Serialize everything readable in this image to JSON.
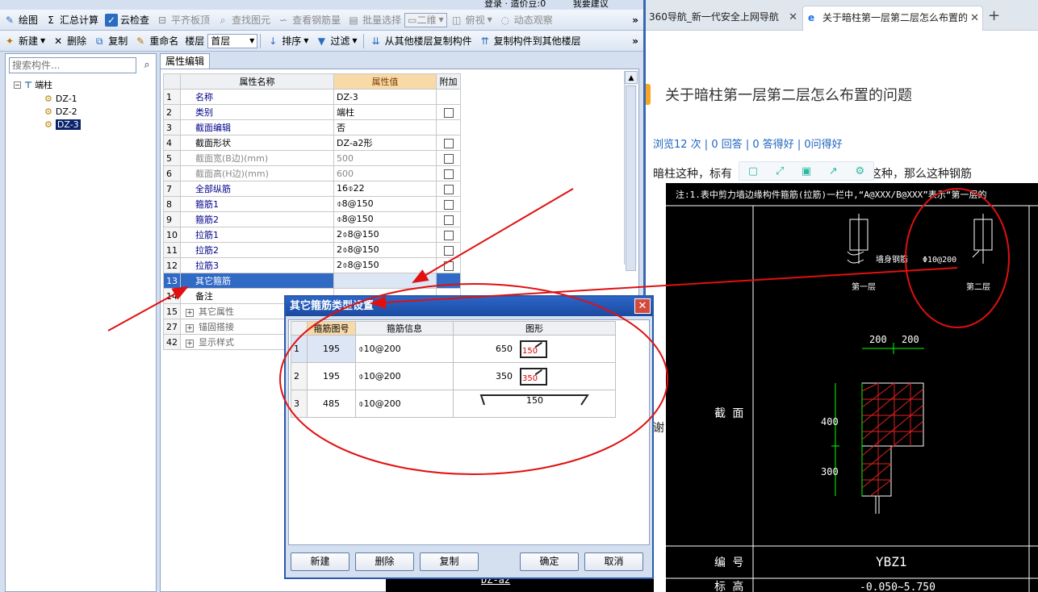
{
  "app": {
    "title_fragment": "登录 · 造价豆:0",
    "title_fragment2": "我要建议",
    "toolbar1": [
      {
        "label": "绘图",
        "icon": "pencil-icon",
        "disabled": false
      },
      {
        "label": "汇总计算",
        "icon": "sigma-icon",
        "disabled": false
      },
      {
        "label": "云检查",
        "icon": "cloud-check-icon",
        "disabled": false
      },
      {
        "label": "平齐板顶",
        "icon": "align-icon",
        "disabled": true
      },
      {
        "label": "查找图元",
        "icon": "find-icon",
        "disabled": true
      },
      {
        "label": "查看钢筋量",
        "icon": "rebar-icon",
        "disabled": true
      },
      {
        "label": "批量选择",
        "icon": "batch-icon",
        "disabled": true
      },
      {
        "label": "二维",
        "icon": "view2d-icon",
        "disabled": true
      },
      {
        "label": "俯视",
        "icon": "topview-icon",
        "disabled": true
      },
      {
        "label": "动态观察",
        "icon": "orbit-icon",
        "disabled": true
      }
    ],
    "toolbar2": {
      "new_label": "新建",
      "delete_label": "删除",
      "copy_label": "复制",
      "rename_label": "重命名",
      "floor_label": "楼层",
      "floor_value": "首层",
      "sort_label": "排序",
      "filter_label": "过滤",
      "copy_from_label": "从其他楼层复制构件",
      "copy_to_label": "复制构件到其他楼层"
    },
    "tree": {
      "search_placeholder": "搜索构件...",
      "root_label": "端柱",
      "items": [
        "DZ-1",
        "DZ-2",
        "DZ-3"
      ],
      "selected": "DZ-3"
    },
    "property_tab": "属性编辑",
    "property_table": {
      "headers": [
        "属性名称",
        "属性值",
        "附加"
      ],
      "rows": [
        {
          "num": "1",
          "name": "名称",
          "value": "DZ-3",
          "check": false,
          "style": "link"
        },
        {
          "num": "2",
          "name": "类别",
          "value": "端柱",
          "check": true,
          "style": "link"
        },
        {
          "num": "3",
          "name": "截面编辑",
          "value": "否",
          "check": false,
          "style": "link"
        },
        {
          "num": "4",
          "name": "截面形状",
          "value": "DZ-a2形",
          "check": true,
          "style": "plain"
        },
        {
          "num": "5",
          "name": "截面宽(B边)(mm)",
          "value": "500",
          "check": true,
          "style": "grey"
        },
        {
          "num": "6",
          "name": "截面高(H边)(mm)",
          "value": "600",
          "check": true,
          "style": "grey"
        },
        {
          "num": "7",
          "name": "全部纵筋",
          "value": "16⌽22",
          "check": true,
          "style": "link"
        },
        {
          "num": "8",
          "name": "箍筋1",
          "value": "⌽8@150",
          "check": true,
          "style": "link"
        },
        {
          "num": "9",
          "name": "箍筋2",
          "value": "⌽8@150",
          "check": true,
          "style": "link"
        },
        {
          "num": "10",
          "name": "拉筋1",
          "value": "2⌽8@150",
          "check": true,
          "style": "link"
        },
        {
          "num": "11",
          "name": "拉筋2",
          "value": "2⌽8@150",
          "check": true,
          "style": "link"
        },
        {
          "num": "12",
          "name": "拉筋3",
          "value": "2⌽8@150",
          "check": true,
          "style": "link"
        },
        {
          "num": "13",
          "name": "其它箍筋",
          "value": "",
          "check": false,
          "style": "selected"
        },
        {
          "num": "14",
          "name": "备注",
          "value": "",
          "check": false,
          "style": "plain"
        },
        {
          "num": "15",
          "name": "其它属性",
          "value": "",
          "check": false,
          "style": "group"
        },
        {
          "num": "27",
          "name": "锚固搭接",
          "value": "",
          "check": false,
          "style": "group"
        },
        {
          "num": "42",
          "name": "显示样式",
          "value": "",
          "check": false,
          "style": "group"
        }
      ]
    }
  },
  "dialog": {
    "title": "其它箍筋类型设置",
    "headers": [
      "箍筋图号",
      "箍筋信息",
      "图形"
    ],
    "rows": [
      {
        "num": "1",
        "code": "195",
        "info": "⌽10@200",
        "len": "650",
        "inner": "150"
      },
      {
        "num": "2",
        "code": "195",
        "info": "⌽10@200",
        "len": "350",
        "inner": "350"
      },
      {
        "num": "3",
        "code": "485",
        "info": "⌽10@200",
        "len": "",
        "inner": "150"
      }
    ],
    "buttons": {
      "new": "新建",
      "delete": "删除",
      "copy": "复制",
      "ok": "确定",
      "cancel": "取消"
    },
    "bottom_label": "DZ-a2"
  },
  "browser": {
    "tab1": "360导航_新一代安全上网导航",
    "tab2": "关于暗柱第一层第二层怎么布置的",
    "question_title": "关于暗柱第一层第二层怎么布置的问题",
    "stats": "浏览12 次 | 0 回答 | 0 答得好 | 0问得好",
    "body_start": "暗柱这种，标有",
    "body_end": "隔一部一这种，那么这种钢筋",
    "body_fragment": "谢",
    "drawing": {
      "note": "注:1.表中剪力墙边缘构件箍筋(拉筋)一栏中,“A@XXX/B@XXX”表示“第一层的",
      "label_wall_rebar": "墙身钢筋",
      "label_spacing": "Φ10@200",
      "label_floor1": "第一层",
      "label_floor2": "第二层",
      "dim_200a": "200",
      "dim_200b": "200",
      "dim_400": "400",
      "dim_300": "300",
      "label_section": "截 面",
      "label_number": "编 号",
      "label_code": "YBZ1",
      "label_elev": "标 高",
      "label_elev_value": "-0.050~5.750"
    }
  },
  "colors": {
    "annotation_red": "#e01010",
    "dialog_title": "#2c66c8",
    "selected_row": "#316ac5",
    "header_orange": "#f8d9a8",
    "link_blue": "#1f64c0"
  }
}
